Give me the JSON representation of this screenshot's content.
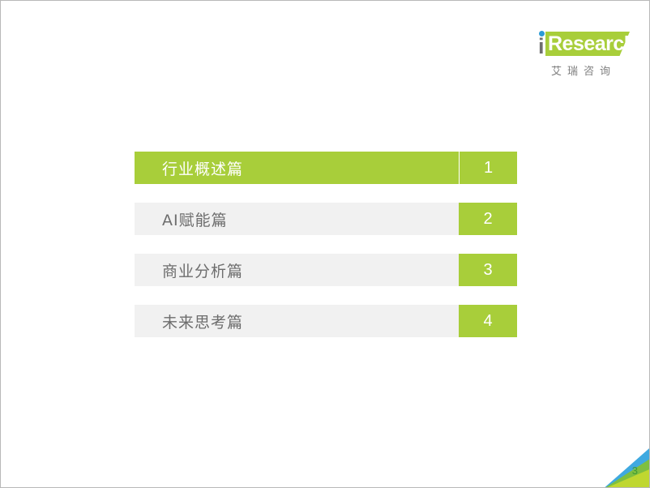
{
  "slide": {
    "page_number": "3",
    "accent_green": "#A8CE3A",
    "accent_blue": "#3FA9E0",
    "row_gray": "#F1F1F1",
    "label_gray": "#6D6D6D"
  },
  "logo": {
    "letter_i": "i",
    "wordmark": "Research",
    "chinese": "艾瑞咨询",
    "dot_color": "#2C9BD6",
    "slab_color": "#A8CE3A"
  },
  "agenda": {
    "rows": [
      {
        "label": "行业概述篇",
        "number": "1",
        "state": "active"
      },
      {
        "label": "AI赋能篇",
        "number": "2",
        "state": "idle"
      },
      {
        "label": "商业分析篇",
        "number": "3",
        "state": "idle"
      },
      {
        "label": "未来思考篇",
        "number": "4",
        "state": "idle"
      }
    ]
  }
}
